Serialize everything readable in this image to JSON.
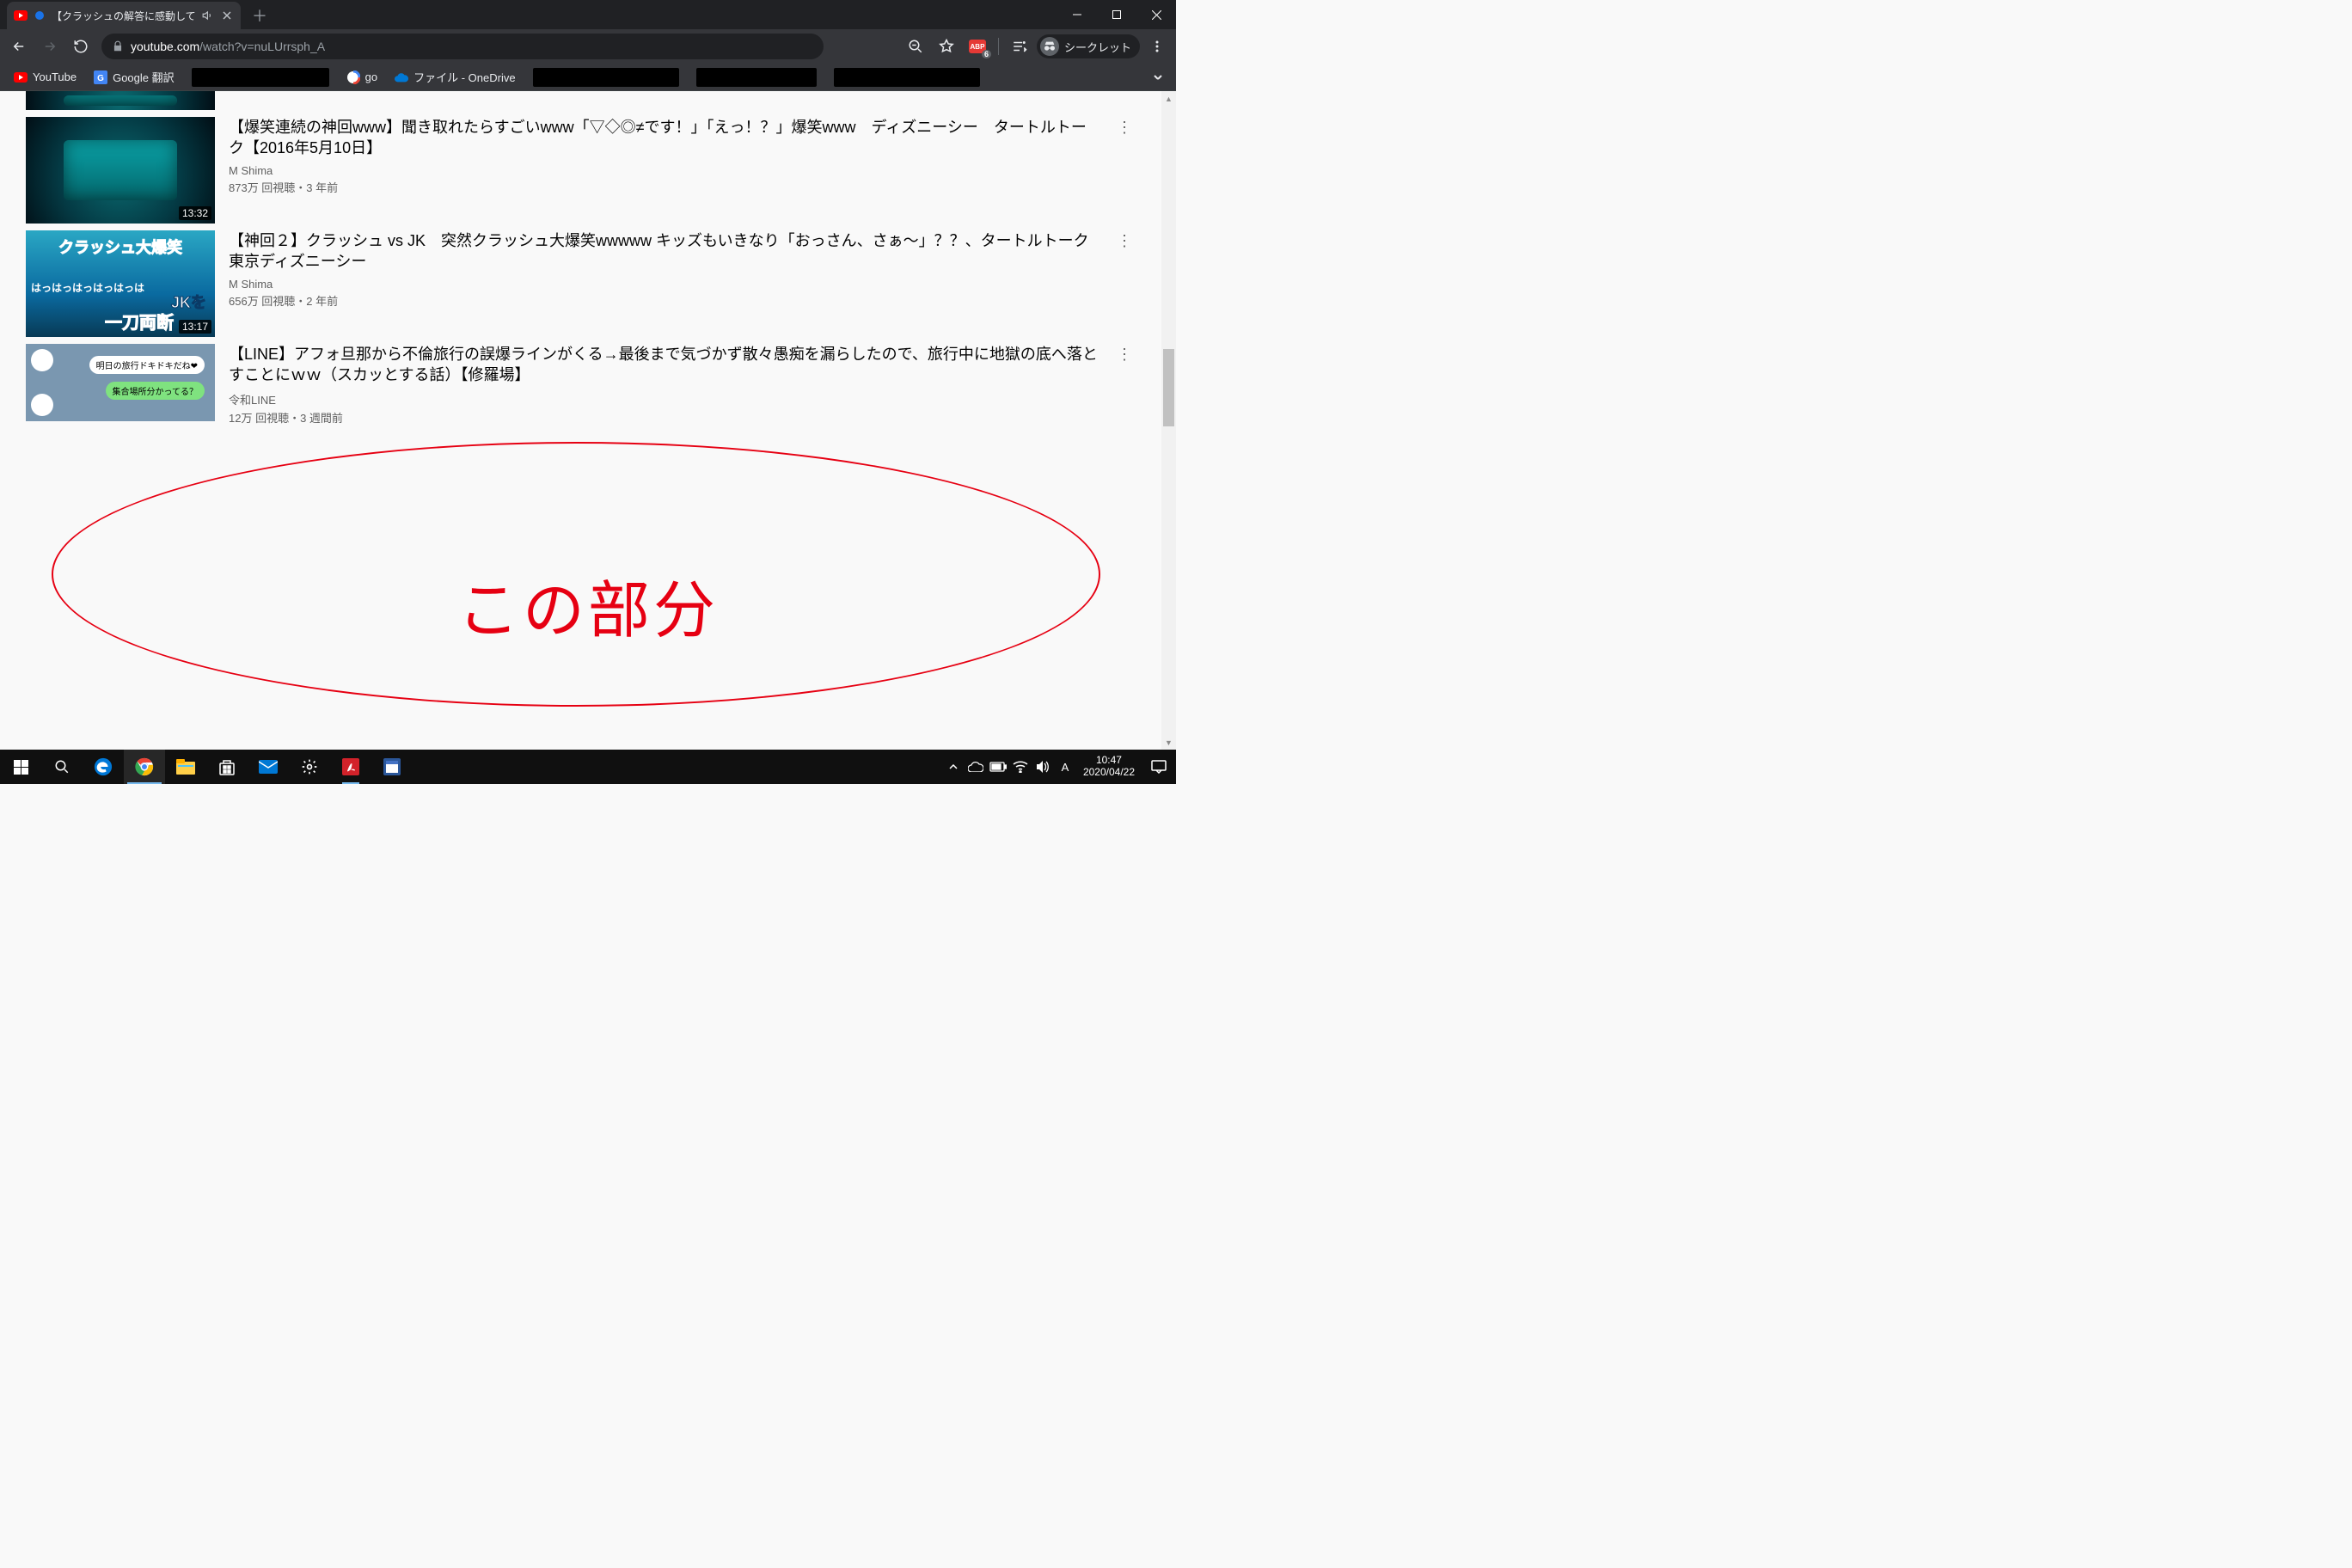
{
  "browser": {
    "tab_title": "【クラッシュの解答に感動して",
    "url_host": "youtube.com",
    "url_path": "/watch?v=nuLUrrsph_A",
    "incognito_label": "シークレット",
    "abp_badge": "6",
    "abp_label": "ABP"
  },
  "bookmarks": {
    "youtube": "YouTube",
    "translate": "Google 翻訳",
    "go": "go",
    "onedrive": "ファイル - OneDrive"
  },
  "videos": [
    {
      "title": "【爆笑連続の神回www】聞き取れたらすごいwww「▽◇◎≠です！」「えっ！？」爆笑www　ディズニーシー　タートルトーク【2016年5月10日】",
      "channel": "M Shima",
      "stats": "873万 回視聴・3 年前",
      "duration": "13:32"
    },
    {
      "title": "【神回２】クラッシュ vs JK　突然クラッシュ大爆笑wwwww キッズもいきなり「おっさん、さぁ〜」？？、タートルトーク　東京ディズニーシー",
      "channel": "M Shima",
      "stats": "656万 回視聴・2 年前",
      "duration": "13:17",
      "thumb_text": {
        "t1": "クラッシュ大爆笑",
        "t2": "はっはっはっはっはっは",
        "t3": "JKを",
        "t4": "一刀両断"
      }
    },
    {
      "title": "【LINE】アフォ旦那から不倫旅行の誤爆ラインがくる→最後まで気づかず散々愚痴を漏らしたので、旅行中に地獄の底へ落とすことにｗｗ（スカッとする話）【修羅場】",
      "channel": "令和LINE",
      "stats": "12万 回視聴・3 週間前",
      "thumb_text": {
        "b1": "明日の旅行ドキドキだね❤",
        "b2": "集合場所分かってる？"
      }
    }
  ],
  "annotation": {
    "text": "この部分"
  },
  "taskbar": {
    "time": "10:47",
    "date": "2020/04/22"
  }
}
